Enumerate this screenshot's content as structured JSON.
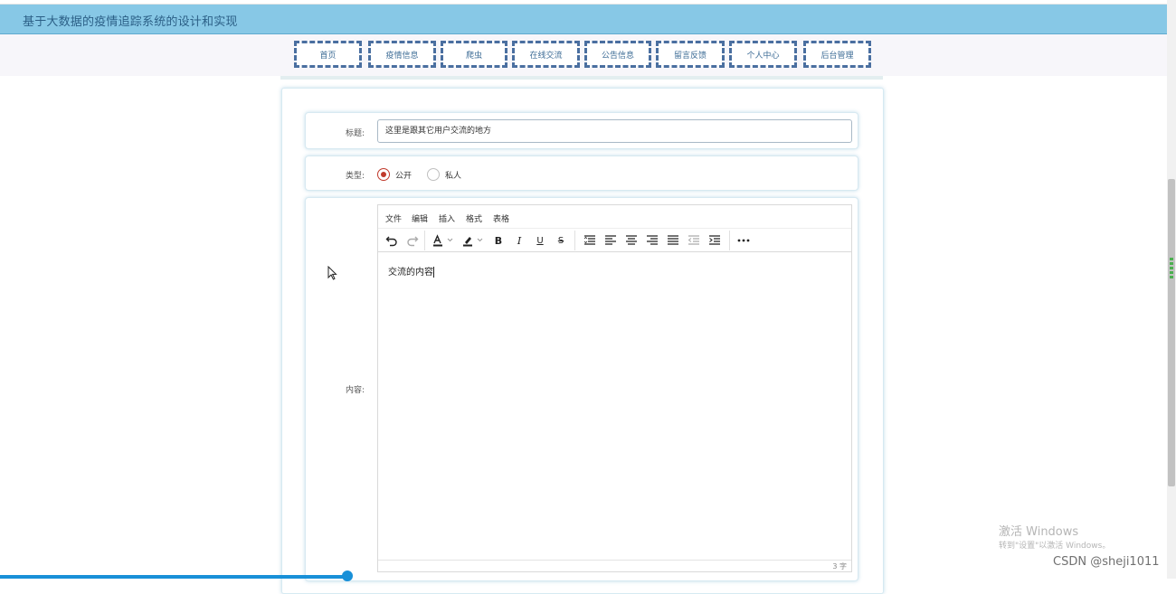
{
  "header": {
    "title": "基于大数据的疫情追踪系统的设计和实现"
  },
  "nav": {
    "items": [
      {
        "label": "首页"
      },
      {
        "label": "疫情信息"
      },
      {
        "label": "爬虫"
      },
      {
        "label": "在线交流"
      },
      {
        "label": "公告信息"
      },
      {
        "label": "留言反馈"
      },
      {
        "label": "个人中心"
      },
      {
        "label": "后台管理"
      }
    ]
  },
  "form": {
    "title_label": "标题:",
    "title_value": "这里是跟其它用户交流的地方",
    "type_label": "类型:",
    "type_options": [
      {
        "label": "公开",
        "checked": true
      },
      {
        "label": "私人",
        "checked": false
      }
    ],
    "content_label": "内容:"
  },
  "editor": {
    "menu": [
      "文件",
      "编辑",
      "插入",
      "格式",
      "表格"
    ],
    "toolbar_icons": [
      "undo-icon",
      "redo-icon",
      "font-color-icon",
      "highlight-color-icon",
      "bold-icon",
      "italic-icon",
      "underline-icon",
      "strikethrough-icon",
      "line-height-icon",
      "align-left-icon",
      "align-center-icon",
      "align-right-icon",
      "align-justify-icon",
      "outdent-icon",
      "indent-icon",
      "more-icon"
    ],
    "content": "交流的内容",
    "word_count": "3 字"
  },
  "watermark": {
    "line1": "激活 Windows",
    "line2": "转到\"设置\"以激活 Windows。"
  },
  "csdn": "CSDN @sheji1011",
  "colors": {
    "header_bg": "#87c8e6",
    "nav_border": "#4a6fa0",
    "accent_red": "#c0392b",
    "progress": "#1890d8"
  }
}
